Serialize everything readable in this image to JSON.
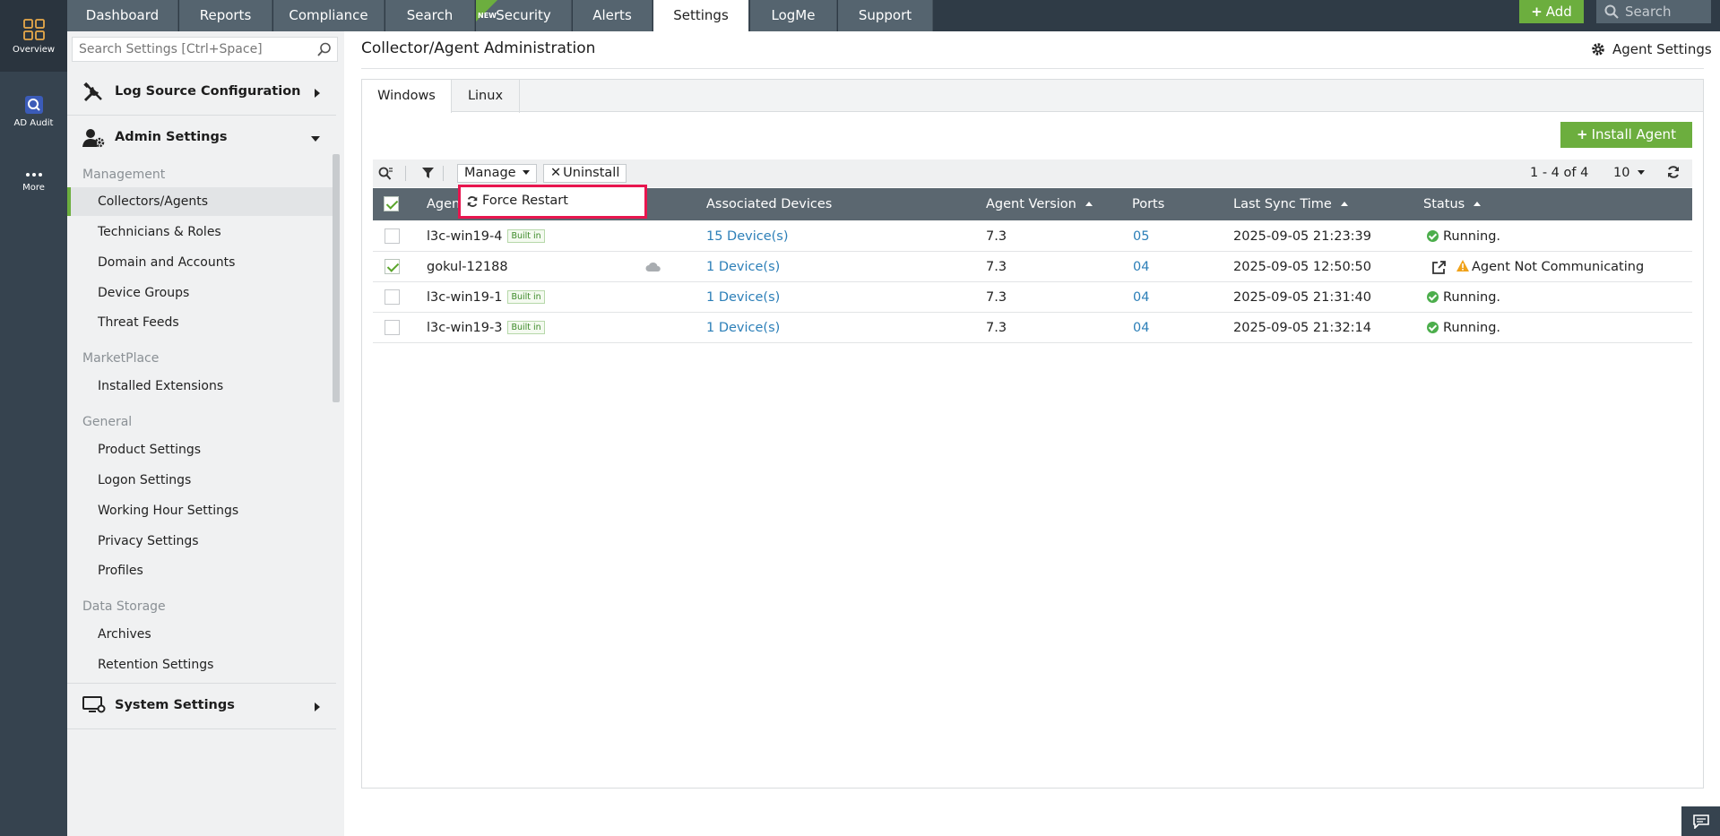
{
  "rail": {
    "items": [
      {
        "label": "Overview",
        "icon": "overview-grid-icon"
      },
      {
        "label": "AD Audit",
        "icon": "ad-audit-icon"
      },
      {
        "label": "More",
        "icon": "more-dots-icon"
      }
    ]
  },
  "topnav": {
    "tabs": [
      "Dashboard",
      "Reports",
      "Compliance",
      "Search",
      "Security",
      "Alerts",
      "Settings",
      "LogMe",
      "Support"
    ],
    "new_badge": "NEW",
    "add_label": "Add",
    "search_placeholder": "Search"
  },
  "sidebar": {
    "search_placeholder": "Search Settings [Ctrl+Space]",
    "sections": {
      "log_source": "Log Source Configuration",
      "admin": "Admin Settings",
      "system": "System Settings"
    },
    "groups": {
      "management": "Management",
      "marketplace": "MarketPlace",
      "general": "General",
      "data_storage": "Data Storage"
    },
    "items": {
      "collectors": "Collectors/Agents",
      "technicians": "Technicians & Roles",
      "domain": "Domain and Accounts",
      "device_groups": "Device Groups",
      "threat_feeds": "Threat Feeds",
      "installed_ext": "Installed Extensions",
      "product": "Product Settings",
      "logon": "Logon Settings",
      "working_hour": "Working Hour Settings",
      "privacy": "Privacy Settings",
      "profiles": "Profiles",
      "archives": "Archives",
      "retention": "Retention Settings"
    }
  },
  "main": {
    "title": "Collector/Agent Administration",
    "agent_settings": "Agent Settings",
    "os_tabs": [
      "Windows",
      "Linux"
    ],
    "install_agent": "Install Agent",
    "toolbar": {
      "manage": "Manage",
      "uninstall": "Uninstall",
      "pager": "1 - 4 of 4",
      "page_size": "10"
    },
    "dropdown_item": "Force Restart",
    "columns": {
      "agent": "Agen",
      "devices": "Associated Devices",
      "version": "Agent Version",
      "ports": "Ports",
      "sync": "Last Sync Time",
      "status": "Status"
    },
    "builtin_label": "Built in",
    "rows": [
      {
        "name": "l3c-win19-4",
        "devices": "15 Device(s)",
        "version": "7.3",
        "ports": "05",
        "sync": "2025-09-05 21:23:39",
        "status": "Running."
      },
      {
        "name": "gokul-12188",
        "devices": "1 Device(s)",
        "version": "7.3",
        "ports": "04",
        "sync": "2025-09-05 12:50:50",
        "status": "Agent Not Communicating"
      },
      {
        "name": "l3c-win19-1",
        "devices": "1 Device(s)",
        "version": "7.3",
        "ports": "04",
        "sync": "2025-09-05 21:31:40",
        "status": "Running."
      },
      {
        "name": "l3c-win19-3",
        "devices": "1 Device(s)",
        "version": "7.3",
        "ports": "04",
        "sync": "2025-09-05 21:32:14",
        "status": "Running."
      }
    ]
  },
  "colors": {
    "rail": "#36434f",
    "nav_tab": "#55646f",
    "accent_green": "#6cae3e",
    "table_header": "#5b6770",
    "link": "#2c7fb8",
    "highlight": "#e8164f"
  }
}
